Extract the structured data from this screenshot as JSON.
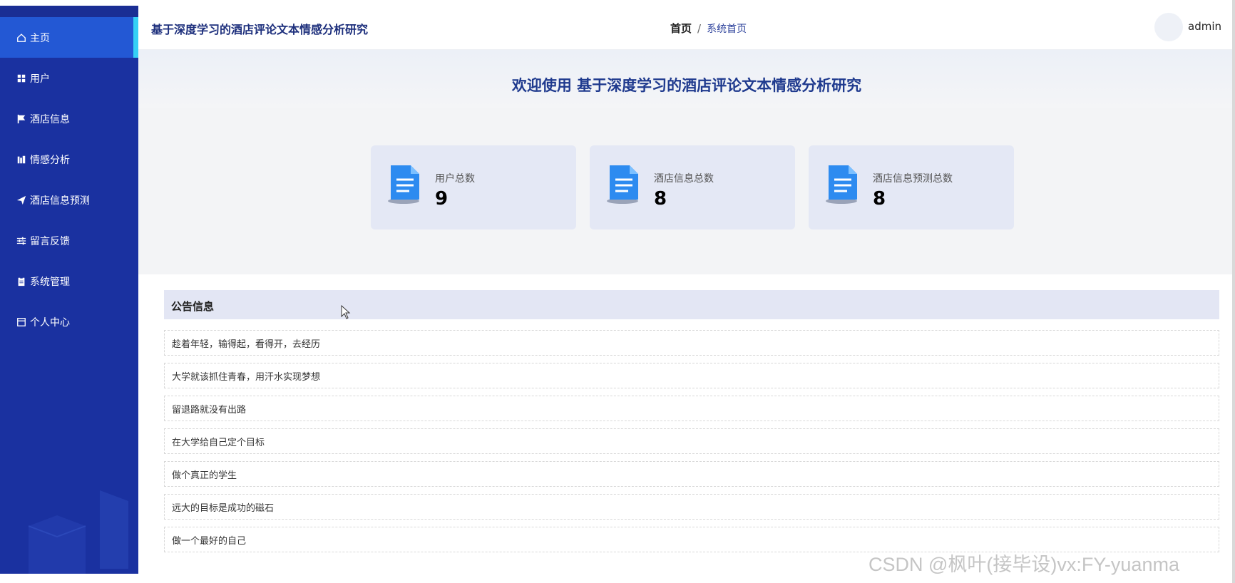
{
  "sidebar": {
    "items": [
      {
        "label": "主页",
        "icon": "home-icon"
      },
      {
        "label": "用户",
        "icon": "grid-icon"
      },
      {
        "label": "酒店信息",
        "icon": "flag-icon"
      },
      {
        "label": "情感分析",
        "icon": "chart-icon"
      },
      {
        "label": "酒店信息预测",
        "icon": "send-icon"
      },
      {
        "label": "留言反馈",
        "icon": "sliders-icon"
      },
      {
        "label": "系统管理",
        "icon": "clipboard-icon"
      },
      {
        "label": "个人中心",
        "icon": "window-icon"
      }
    ]
  },
  "header": {
    "title": "基于深度学习的酒店评论文本情感分析研究",
    "breadcrumb_home": "首页",
    "breadcrumb_sep": "/",
    "breadcrumb_current": "系统首页",
    "username": "admin"
  },
  "welcome": {
    "text": "欢迎使用 基于深度学习的酒店评论文本情感分析研究"
  },
  "stats": [
    {
      "label": "用户总数",
      "value": "9"
    },
    {
      "label": "酒店信息总数",
      "value": "8"
    },
    {
      "label": "酒店信息预测总数",
      "value": "8"
    }
  ],
  "notices": {
    "title": "公告信息",
    "items": [
      "趁着年轻，输得起，看得开，去经历",
      "大学就该抓住青春，用汗水实现梦想",
      "留退路就没有出路",
      "在大学给自己定个目标",
      "做个真正的学生",
      "远大的目标是成功的磁石",
      "做一个最好的自己"
    ]
  },
  "watermark": "CSDN @枫叶(接毕设)vx:FY-yuanma",
  "colors": {
    "sidebar_bg": "#1a31a0",
    "sidebar_active": "#2358d4",
    "active_indicator": "#35d0f5",
    "title_blue": "#1f3a8e",
    "card_bg": "#e4e8f5"
  }
}
